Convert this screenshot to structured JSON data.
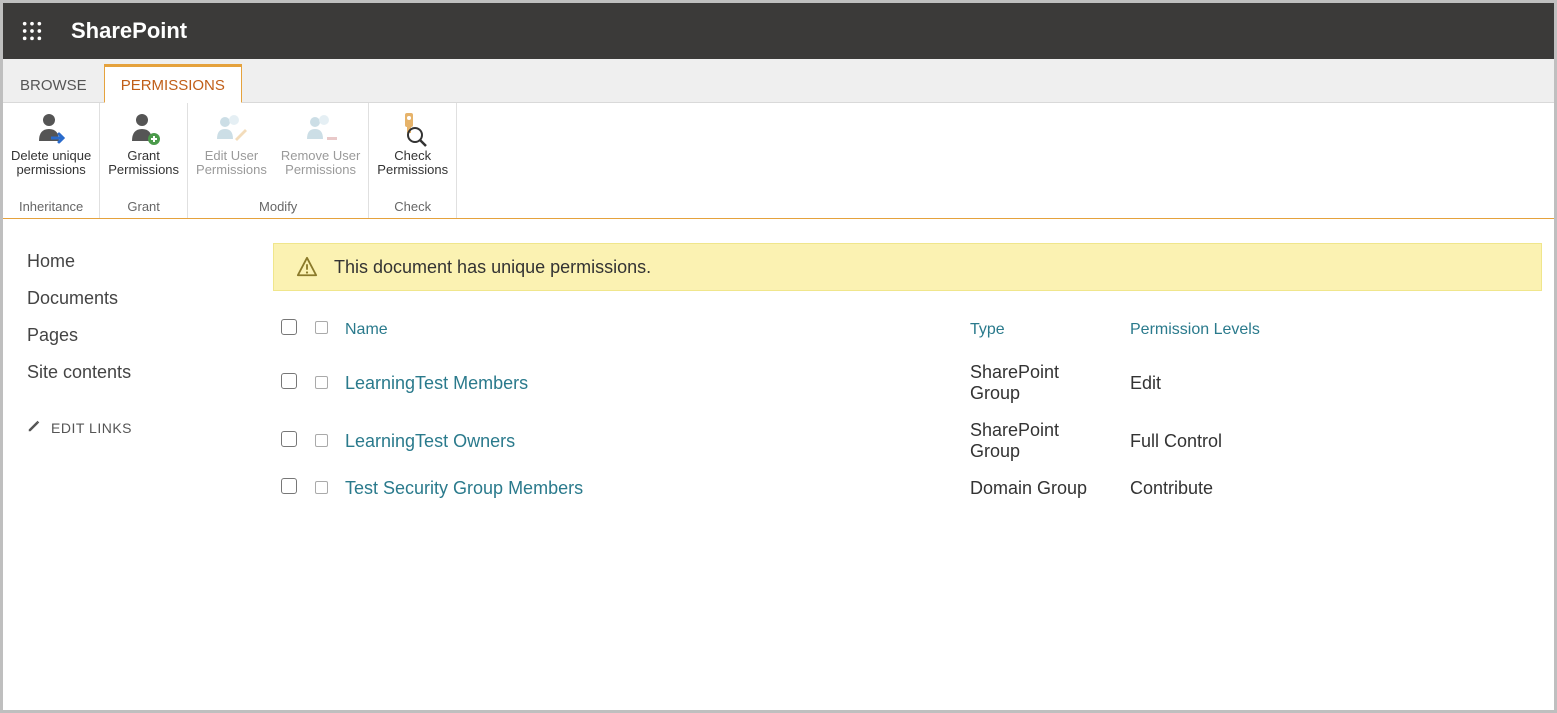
{
  "suite": {
    "title": "SharePoint"
  },
  "tabs": {
    "browse": "BROWSE",
    "permissions": "PERMISSIONS"
  },
  "ribbon": {
    "delete_unique": "Delete unique\npermissions",
    "grant": "Grant\nPermissions",
    "edit_user": "Edit User\nPermissions",
    "remove_user": "Remove User\nPermissions",
    "check": "Check\nPermissions",
    "group_inheritance": "Inheritance",
    "group_grant": "Grant",
    "group_modify": "Modify",
    "group_check": "Check"
  },
  "leftnav": {
    "items": [
      {
        "label": "Home"
      },
      {
        "label": "Documents"
      },
      {
        "label": "Pages"
      },
      {
        "label": "Site contents"
      }
    ],
    "edit_links": "EDIT LINKS"
  },
  "message": "This document has unique permissions.",
  "table": {
    "columns": {
      "name": "Name",
      "type": "Type",
      "levels": "Permission Levels"
    },
    "rows": [
      {
        "name": "LearningTest Members",
        "type": "SharePoint Group",
        "level": "Edit"
      },
      {
        "name": "LearningTest Owners",
        "type": "SharePoint Group",
        "level": "Full Control"
      },
      {
        "name": "Test Security Group Members",
        "type": "Domain Group",
        "level": "Contribute"
      }
    ]
  }
}
